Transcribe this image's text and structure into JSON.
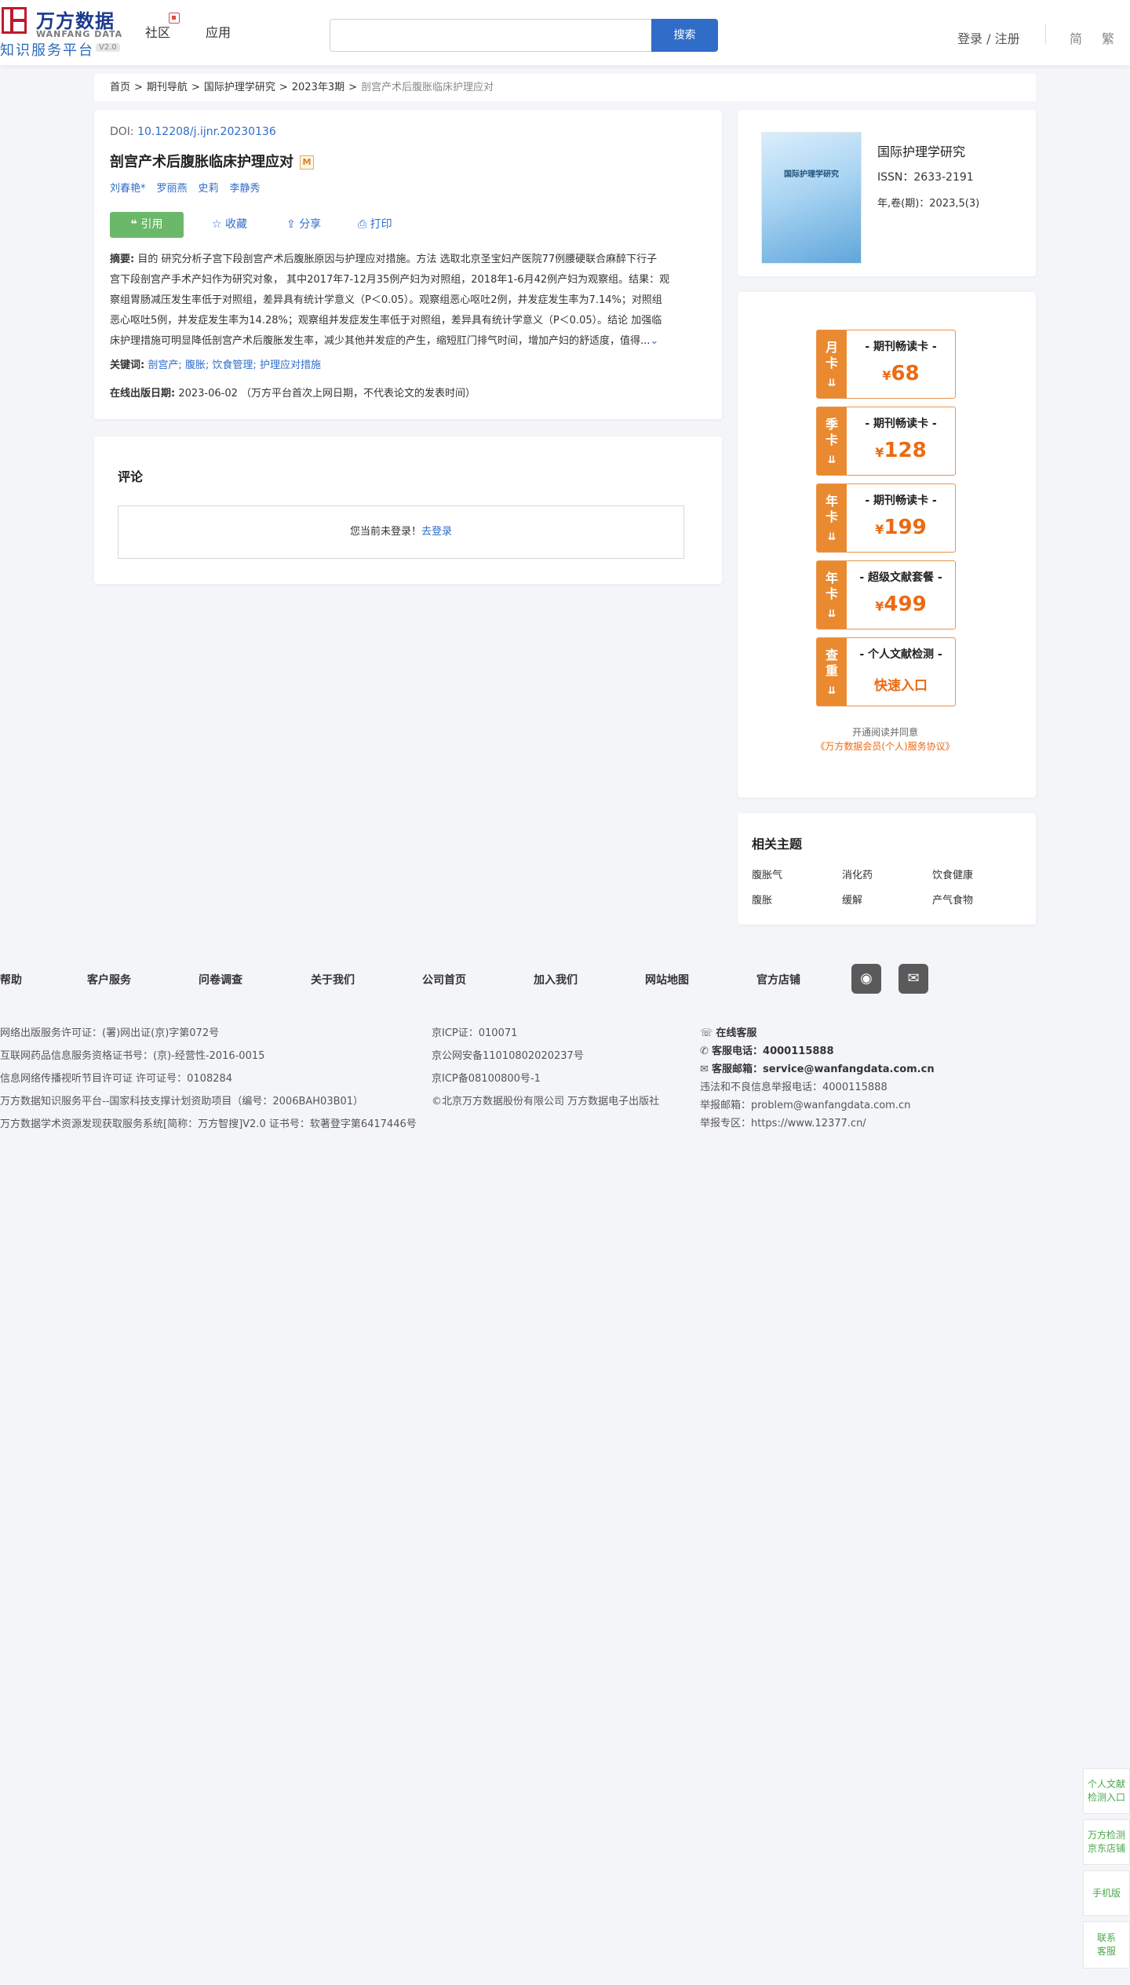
{
  "header": {
    "logo_cn": "万方数据",
    "logo_en": "WANFANG DATA",
    "logo_sub": "知识服务平台",
    "logo_ver": "V2.0",
    "nav": [
      "社区",
      "应用"
    ],
    "search_placeholder": "",
    "search_btn": "搜索",
    "login": "登录 / 注册",
    "lang_simplified": "简",
    "lang_traditional": "繁"
  },
  "breadcrumb": {
    "items": [
      "首页",
      "期刊导航",
      "国际护理学研究",
      "2023年3期"
    ],
    "current": "剖宫产术后腹胀临床护理应对",
    "sep": ">"
  },
  "article": {
    "doi_label": "DOI:",
    "doi": "10.12208/j.ijnr.20230136",
    "title": "剖宫产术后腹胀临床护理应对",
    "title_badge": "M",
    "authors": [
      "刘春艳*",
      "罗丽燕",
      "史莉",
      "李静秀"
    ],
    "actions": {
      "cite": "引用",
      "collect": "收藏",
      "share": "分享",
      "print": "打印"
    },
    "abstract_label": "摘要:",
    "abstract_lines": [
      "目的  研究分析子宫下段剖宫产术后腹胀原因与护理应对措施。方法  选取北京圣宝妇产医院77例腰硬联合麻醉下行子",
      "宫下段剖宫产手术产妇作为研究对象，  其中2017年7-12月35例产妇为对照组，2018年1-6月42例产妇为观察组。结果：观",
      "察组胃肠减压发生率低于对照组，差异具有统计学意义（P＜0.05）。观察组恶心呕吐2例，并发症发生率为7.14%；对照组",
      "恶心呕吐5例，并发症发生率为14.28%；观察组并发症发生率低于对照组，差异具有统计学意义（P＜0.05）。结论  加强临",
      "床护理措施可明显降低剖宫产术后腹胀发生率，减少其他并发症的产生，缩短肛门排气时间，增加产妇的舒适度，值得..."
    ],
    "keywords_label": "关键词:",
    "keywords": [
      "剖宫产;",
      "腹胀;",
      "饮食管理;",
      "护理应对措施"
    ],
    "pubdate_label": "在线出版日期:",
    "pubdate": "2023-06-02",
    "pubdate_note": "（万方平台首次上网日期，不代表论文的发表时间）"
  },
  "comment": {
    "title": "评论",
    "not_login": "您当前未登录！",
    "go_login": "去登录"
  },
  "journal": {
    "cover_title": "国际护理学研究",
    "name": "国际护理学研究",
    "issn": "ISSN：2633-2191",
    "year": "年,卷(期)：2023,5(3)"
  },
  "cards": [
    {
      "tag": [
        "月",
        "卡"
      ],
      "name": "- 期刊畅读卡 -",
      "currency": "¥",
      "price": "68"
    },
    {
      "tag": [
        "季",
        "卡"
      ],
      "name": "- 期刊畅读卡 -",
      "currency": "¥",
      "price": "128"
    },
    {
      "tag": [
        "年",
        "卡"
      ],
      "name": "- 期刊畅读卡 -",
      "currency": "¥",
      "price": "199"
    },
    {
      "tag": [
        "年",
        "卡"
      ],
      "name": "- 超级文献套餐 -",
      "currency": "¥",
      "price": "499"
    },
    {
      "tag": [
        "查",
        "重"
      ],
      "name": "- 个人文献检测 -",
      "link": "快速入口"
    }
  ],
  "agreement": {
    "line1": "开通阅读并同意",
    "line2": "《万方数据会员(个人)服务协议》"
  },
  "related": {
    "title": "相关主题",
    "items": [
      "腹胀气",
      "消化药",
      "饮食健康",
      "腹胀",
      "缓解",
      "产气食物"
    ]
  },
  "footer": {
    "links": [
      "帮助",
      "客户服务",
      "问卷调查",
      "关于我们",
      "公司首页",
      "加入我们",
      "网站地图",
      "官方店铺"
    ],
    "col1": [
      "网络出版服务许可证：(署)网出证(京)字第072号",
      "互联网药品信息服务资格证书号：(京)-经营性-2016-0015",
      "信息网络传播视听节目许可证 许可证号：0108284",
      "万方数据知识服务平台--国家科技支撑计划资助项目（编号：2006BAH03B01）",
      "万方数据学术资源发现获取服务系统[简称：万方智搜]V2.0 证书号：软著登字第6417446号"
    ],
    "col2": [
      "京ICP证：010071",
      "京公网安备11010802020237号",
      "京ICP备08100800号-1",
      "©北京万方数据股份有限公司 万方数据电子出版社"
    ],
    "service_title": "在线客服",
    "phone_label": "客服电话：",
    "phone": "4000115888",
    "email_label": "客服邮箱：",
    "email": "service@wanfangdata.com.cn",
    "report_phone": "违法和不良信息举报电话：4000115888",
    "report_email": "举报邮箱：problem@wanfangdata.com.cn",
    "report_zone": "举报专区：https://www.12377.cn/"
  },
  "float": [
    [
      "个人文献",
      "检测入口"
    ],
    [
      "万方检测",
      "京东店铺"
    ],
    [
      "手机版"
    ],
    [
      "联系",
      "客服"
    ]
  ],
  "colors": {
    "brand_blue": "#2f6dc9",
    "orange": "#ea8a30",
    "green": "#6bb86b",
    "red": "#c0192d"
  }
}
